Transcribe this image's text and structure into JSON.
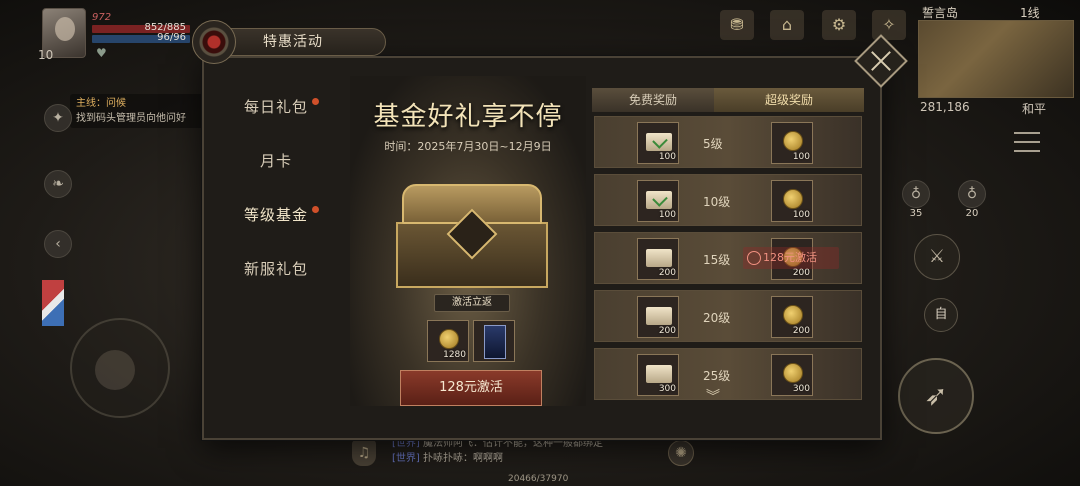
{
  "hud": {
    "level": "10",
    "player_name": "972",
    "hp_text": "852/885",
    "mp_text": "96/96",
    "quest_title": "主线：问候",
    "quest_desc": "找到码头管理员向他问好",
    "location": "誓言岛",
    "channel": "1线",
    "coords": "281,186",
    "mode": "和平",
    "skill_charges": [
      "35",
      "20"
    ],
    "auto_label": "自",
    "exp_text": "20466/37970"
  },
  "chat": {
    "lines": [
      {
        "channel": "[世界]",
        "speaker": "魔法师阿飞：",
        "text": "估计不能，这种一般都绑定"
      },
      {
        "channel": "[世界]",
        "speaker": "扑哧扑哧：",
        "text": "啊啊啊"
      }
    ]
  },
  "dialog": {
    "title": "特惠活动",
    "nav": [
      {
        "label": "每日礼包",
        "dot": true
      },
      {
        "label": "月卡",
        "dot": false
      },
      {
        "label": "等级基金",
        "dot": true
      },
      {
        "label": "新服礼包",
        "dot": false
      }
    ],
    "promo": {
      "title": "基金好礼享不停",
      "time": "时间：2025年7月30日~12月9日",
      "rebate_label": "激活立返",
      "rebate_items": [
        {
          "type": "coin",
          "qty": "1280"
        },
        {
          "type": "card",
          "qty": ""
        }
      ],
      "activate_button": "128元激活"
    },
    "rewards": {
      "free_header": "免费奖励",
      "super_header": "超级奖励",
      "locked_label": "128元激活",
      "rows": [
        {
          "level": "5级",
          "free_type": "ticket-green",
          "free_qty": "100",
          "super_qty": "100",
          "locked": false
        },
        {
          "level": "10级",
          "free_type": "ticket-green",
          "free_qty": "100",
          "super_qty": "100",
          "locked": false
        },
        {
          "level": "15级",
          "free_type": "ticket",
          "free_qty": "200",
          "super_qty": "200",
          "locked": true
        },
        {
          "level": "20级",
          "free_type": "ticket",
          "free_qty": "200",
          "super_qty": "200",
          "locked": false
        },
        {
          "level": "25级",
          "free_type": "ticket",
          "free_qty": "300",
          "super_qty": "300",
          "locked": false
        }
      ]
    }
  }
}
